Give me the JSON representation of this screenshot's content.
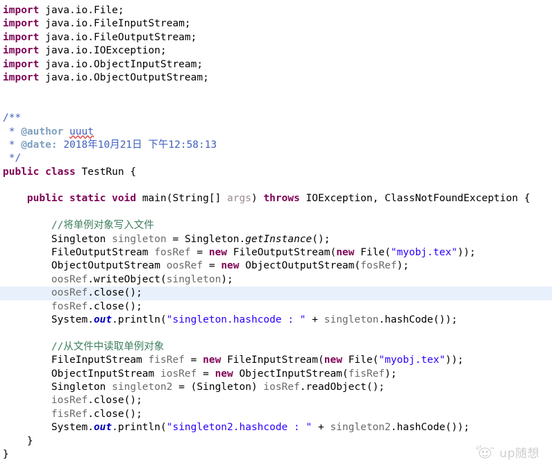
{
  "editor": {
    "language": "Java",
    "class_name": "TestRun",
    "highlighted_line_index": 19,
    "colors": {
      "background": "#ffffff",
      "keyword": "#7f0055",
      "string": "#2a00ff",
      "line_comment": "#3f7f5f",
      "javadoc": "#3f5fbf",
      "javadoc_tag": "#7f9fbf",
      "identifier": "#6a6a6a",
      "static_field": "#0000c0",
      "current_line_highlight": "#e8f0fb",
      "spellcheck_underline": "#e04040"
    }
  },
  "code": {
    "imports": [
      {
        "keyword": "import",
        "path": " java.io.File;"
      },
      {
        "keyword": "import",
        "path": " java.io.FileInputStream;"
      },
      {
        "keyword": "import",
        "path": " java.io.FileOutputStream;"
      },
      {
        "keyword": "import",
        "path": " java.io.IOException;"
      },
      {
        "keyword": "import",
        "path": " java.io.ObjectInputStream;"
      },
      {
        "keyword": "import",
        "path": " java.io.ObjectOutputStream;"
      }
    ],
    "javadoc": {
      "open": "/**",
      "author_star": " * ",
      "author_tag": "@author",
      "author_space": " ",
      "author_name": "uuut",
      "date_star": " * ",
      "date_tag": "@date:",
      "date_value": " 2018年10月21日 下午12:58:13",
      "close": " */"
    },
    "class_decl": {
      "modifier": "public",
      "sp1": " ",
      "kw_class": "class",
      "sp2": " ",
      "name": "TestRun",
      "brace": " {"
    },
    "method_decl": {
      "indent": "    ",
      "modifier": "public",
      "sp1": " ",
      "static_kw": "static",
      "sp2": " ",
      "return_type": "void",
      "sp3": " ",
      "name": "main(String[] ",
      "param": "args",
      "after_param": ") ",
      "throws_kw": "throws",
      "exceptions": " IOException, ClassNotFoundException {"
    },
    "block_write": {
      "comment": "        //将单例对象写入文件",
      "line_singleton": {
        "indent": "        ",
        "type": "Singleton ",
        "var": "singleton",
        "eq": " = ",
        "owner": "Singleton.",
        "method": "getInstance",
        "tail": "();"
      },
      "line_fos": {
        "indent": "        ",
        "type": "FileOutputStream ",
        "var": "fosRef",
        "eq": " = ",
        "new1": "new",
        "mid": " FileOutputStream(",
        "new2": "new",
        "file": " File(",
        "str": "\"myobj.tex\"",
        "tail": "));"
      },
      "line_oos": {
        "indent": "        ",
        "type": "ObjectOutputStream ",
        "var": "oosRef",
        "eq": " = ",
        "new1": "new",
        "mid": " ObjectOutputStream(",
        "arg": "fosRef",
        "tail": ");"
      },
      "line_write": {
        "indent": "        ",
        "obj": "oosRef",
        "call": ".writeObject(",
        "arg": "singleton",
        "tail": ");"
      },
      "line_close_oos": {
        "indent": "        ",
        "obj": "oosRef",
        "tail": ".close();"
      },
      "line_close_fos": {
        "indent": "        ",
        "obj": "fosRef",
        "tail": ".close();"
      },
      "line_print": {
        "indent": "        ",
        "system": "System.",
        "out": "out",
        "println": ".println(",
        "str": "\"singleton.hashcode : \"",
        "plus": " + ",
        "var": "singleton",
        "tail": ".hashCode());"
      }
    },
    "block_read": {
      "comment": "        //从文件中读取单例对象",
      "line_fis": {
        "indent": "        ",
        "type": "FileInputStream ",
        "var": "fisRef",
        "eq": " = ",
        "new1": "new",
        "mid": " FileInputStream(",
        "new2": "new",
        "file": " File(",
        "str": "\"myobj.tex\"",
        "tail": "));"
      },
      "line_ios": {
        "indent": "        ",
        "type": "ObjectInputStream ",
        "var": "iosRef",
        "eq": " = ",
        "new1": "new",
        "mid": " ObjectInputStream(",
        "arg": "fisRef",
        "tail": ");"
      },
      "line_singleton2": {
        "indent": "        ",
        "type": "Singleton ",
        "var": "singleton2",
        "eq": " = (Singleton) ",
        "obj": "iosRef",
        "tail": ".readObject();"
      },
      "line_close_ios": {
        "indent": "        ",
        "obj": "iosRef",
        "tail": ".close();"
      },
      "line_close_fis": {
        "indent": "        ",
        "obj": "fisRef",
        "tail": ".close();"
      },
      "line_print": {
        "indent": "        ",
        "system": "System.",
        "out": "out",
        "println": ".println(",
        "str": "\"singleton2.hashcode : \"",
        "plus": " + ",
        "var": "singleton2",
        "tail": ".hashCode());"
      }
    },
    "close_method": "    }",
    "close_class": "}"
  },
  "watermark": {
    "text": "up随想",
    "icon": "smiley-face-icon"
  }
}
